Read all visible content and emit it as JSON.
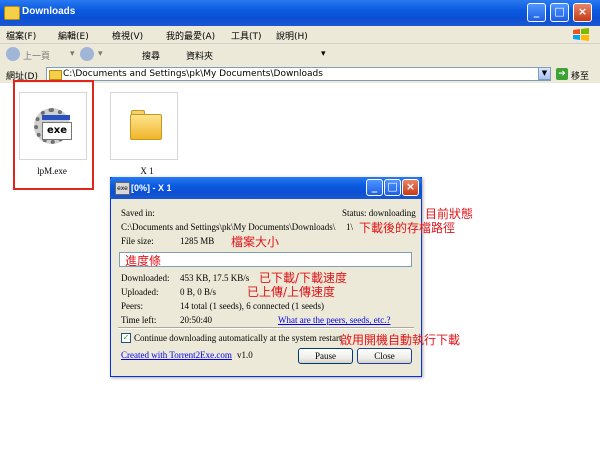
{
  "window": {
    "title": "Downloads",
    "controls": {
      "minimize": "_",
      "maximize": "□",
      "close": "×"
    }
  },
  "menu": [
    "檔案(F)",
    "編輯(E)",
    "檢視(V)",
    "我的最愛(A)",
    "工具(T)",
    "說明(H)"
  ],
  "toolbar": {
    "back": "上一頁",
    "search": "搜尋",
    "folders": "資料夾"
  },
  "address": {
    "label": "網址(D)",
    "path": "C:\\Documents and Settings\\pk\\My Documents\\Downloads",
    "go": "移至"
  },
  "files": [
    {
      "name": "lpM.exe",
      "icon": "exe-gear-icon",
      "thumb_label": "exe"
    },
    {
      "name": "X      1",
      "icon": "folder-icon"
    }
  ],
  "dialog": {
    "title": "[0%] - X        1",
    "icon_label": "exe",
    "saved_in_label": "Saved in:",
    "saved_path": "C:\\Documents and Settings\\pk\\My Documents\\Downloads\\X\\",
    "path_suffix": "1\\",
    "status": "Status: downloading",
    "file_size_label": "File size:",
    "file_size": "1285 MB",
    "progress_percent": 0,
    "downloaded_label": "Downloaded:",
    "downloaded": "453 KB, 17.5 KB/s",
    "uploaded_label": "Uploaded:",
    "uploaded": "0 B, 0 B/s",
    "peers_label": "Peers:",
    "peers": "14 total (1 seeds), 6 connected (1 seeds)",
    "time_left_label": "Time left:",
    "time_left": "20:50:40",
    "peers_link": "What are the peers, seeds, etc.?",
    "continue_label": "Continue downloading automatically at the system restart",
    "continue_checked": true,
    "credit_link": "Created with Torrent2Exe.com",
    "version": "v1.0",
    "pause_button": "Pause",
    "close_button": "Close"
  },
  "annotations": {
    "status": "目前狀態",
    "save_path": "下載後的存檔路徑",
    "file_size": "檔案大小",
    "progress": "進度條",
    "download_speed": "已下載/下載速度",
    "upload_speed": "已上傳/上傳速度",
    "auto_start": "啟用開機自動執行下載"
  },
  "colors": {
    "titlebar": "#0b4fd3",
    "annotation": "#e0141a",
    "highlight_frame": "#e0261b"
  }
}
